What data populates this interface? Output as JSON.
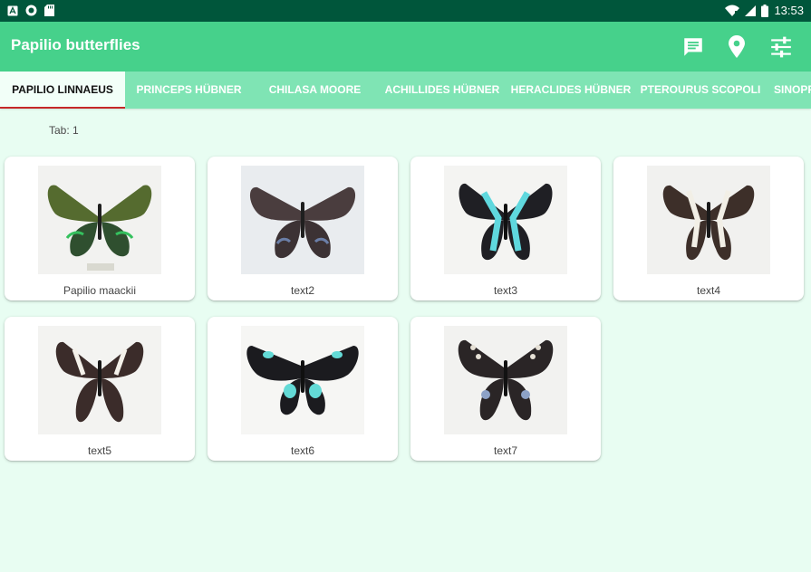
{
  "status_bar": {
    "left_icons": [
      "a-notification-icon",
      "sync-icon",
      "sd-card-icon"
    ],
    "right_icons": [
      "wifi-icon",
      "signal-icon",
      "battery-icon"
    ],
    "time": "13:53"
  },
  "app_bar": {
    "title": "Papilio butterflies",
    "actions": [
      "message-icon",
      "location-icon",
      "tune-icon"
    ],
    "color": "#46d18b"
  },
  "tabs": {
    "items": [
      {
        "label": "PAPILIO LINNAEUS",
        "active": true
      },
      {
        "label": "PRINCEPS HÜBNER",
        "active": false
      },
      {
        "label": "CHILASA MOORE",
        "active": false
      },
      {
        "label": "ACHILLIDES HÜBNER",
        "active": false
      },
      {
        "label": "HERACLIDES HÜBNER",
        "active": false
      },
      {
        "label": "PTEROURUS SCOPOLI",
        "active": false
      },
      {
        "label": "SINOPR",
        "active": false
      }
    ],
    "indicator_color": "#c62828"
  },
  "content": {
    "tab_indicator": "Tab: 1",
    "cards": [
      {
        "label": "Papilio maackii",
        "image": "butterfly-green"
      },
      {
        "label": "text2",
        "image": "butterfly-dark-grey"
      },
      {
        "label": "text3",
        "image": "butterfly-blue-banded"
      },
      {
        "label": "text4",
        "image": "butterfly-white-banded"
      },
      {
        "label": "text5",
        "image": "butterfly-white-swallowtail"
      },
      {
        "label": "text6",
        "image": "butterfly-cyan-spotted"
      },
      {
        "label": "text7",
        "image": "butterfly-spotted-swallowtail"
      }
    ]
  },
  "colors": {
    "status_bar": "#00563b",
    "background": "#e8fdf2",
    "tabs_background": "#7fe4b4"
  }
}
